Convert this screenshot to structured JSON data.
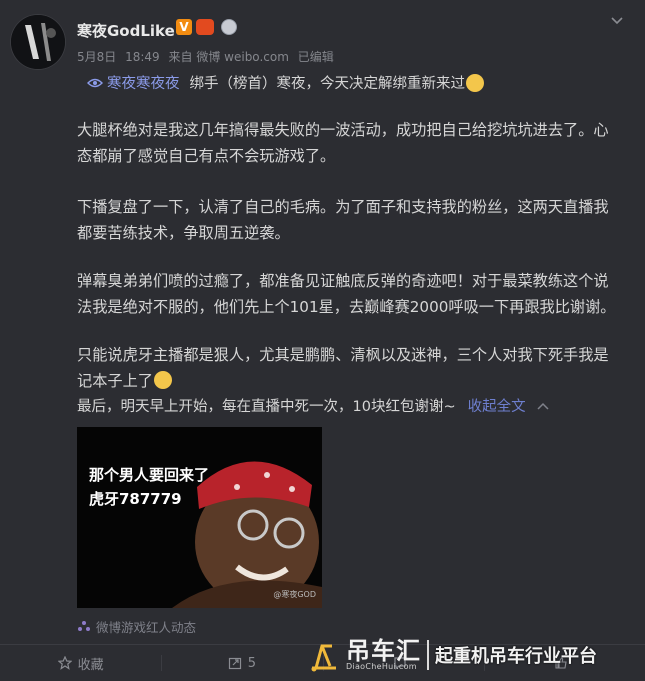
{
  "post": {
    "author": "寒夜GodLike",
    "meta": {
      "date": "5月8日",
      "time": "18:49",
      "source": "来自 微博 weibo.com",
      "edited": "已编辑"
    },
    "topic": "寒夜寒夜夜",
    "quote_text": "绑手（榜首）寒夜，今天决定解绑重新来过",
    "paragraphs": [
      "大腿杯绝对是我这几年搞得最失败的一波活动，成功把自己给挖坑坑进去了。心态都崩了感觉自己有点不会玩游戏了。",
      "下播复盘了一下，认清了自己的毛病。为了面子和支持我的粉丝，这两天直播我都要苦练技术，争取周五逆袭。",
      "弹幕臭弟弟们喷的过瘾了，都准备见证触底反弹的奇迹吧！对于最菜教练这个说法我是绝对不服的，他们先上个101星，去巅峰赛2000呼吸一下再跟我比谢谢。",
      "只能说虎牙主播都是狠人，尤其是鹏鹏、清枫以及迷神，三个人对我下死手我是记本子上了"
    ],
    "last_line": "最后，明天早上开始，每在直播中死一次，10块红包谢谢~",
    "collapse_label": "收起全文",
    "image": {
      "caption_line1": "那个男人要回来了",
      "caption_line2": "虎牙787779",
      "watermark": "@寒夜GOD"
    },
    "source_tag": "微博游戏红人动态"
  },
  "actions": [
    {
      "label": "收藏",
      "icon": "star-icon"
    },
    {
      "label": "5",
      "icon": "repost-icon"
    },
    {
      "label": "",
      "icon": "comment-icon"
    },
    {
      "label": "",
      "icon": "like-icon"
    }
  ],
  "watermark": {
    "logo_text": "吊车汇",
    "domain": "DiaoCheHui.com",
    "slogan": "起重机吊车行业平台"
  },
  "colors": {
    "background": "#2c2d32",
    "link": "#8b9be9",
    "text": "#d6d6d6",
    "muted": "#85878d"
  }
}
